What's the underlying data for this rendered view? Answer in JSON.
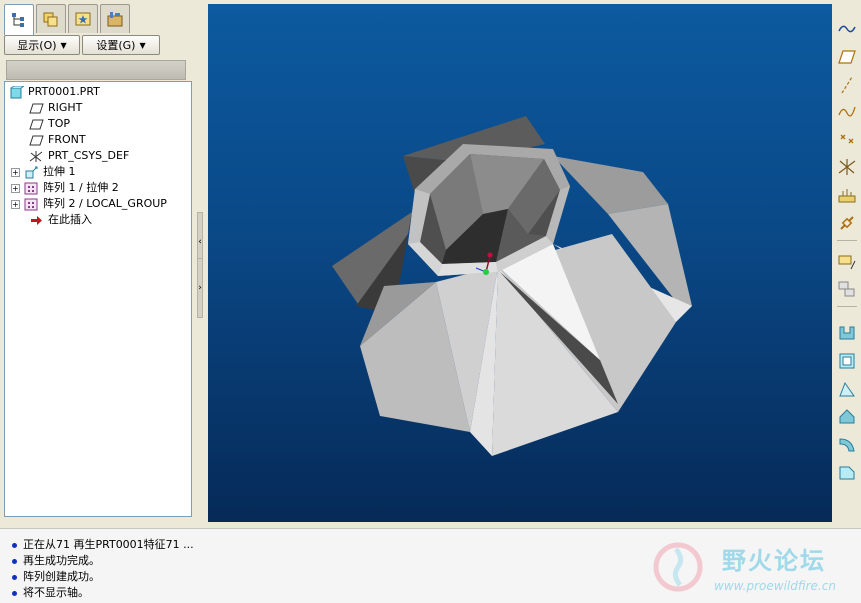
{
  "nav_tabs": [
    {
      "name": "model-tree-tab",
      "icon": "model-tree-icon"
    },
    {
      "name": "folder-browser-tab",
      "icon": "folder-icon"
    },
    {
      "name": "favorites-tab",
      "icon": "favorites-icon"
    },
    {
      "name": "connections-tab",
      "icon": "connections-icon"
    }
  ],
  "tree_toolbar": {
    "show_label": "显示(O)",
    "settings_label": "设置(G)"
  },
  "tree": {
    "root": "PRT0001.PRT",
    "items": [
      {
        "label": "RIGHT",
        "icon": "datum-plane-icon"
      },
      {
        "label": "TOP",
        "icon": "datum-plane-icon"
      },
      {
        "label": "FRONT",
        "icon": "datum-plane-icon"
      },
      {
        "label": "PRT_CSYS_DEF",
        "icon": "coordinate-system-icon"
      },
      {
        "label": "拉伸 1",
        "icon": "extrude-icon"
      },
      {
        "label": "阵列 1 / 拉伸 2",
        "icon": "pattern-icon"
      },
      {
        "label": "阵列 2 / LOCAL_GROUP",
        "icon": "pattern-icon"
      },
      {
        "label": "在此插入",
        "icon": "insert-here-arrow-icon"
      }
    ]
  },
  "messages": [
    "正在从71 再生PRT0001特征71 ...",
    "再生成功完成。",
    "阵列创建成功。",
    "将不显示轴。"
  ],
  "watermark": {
    "title": "野火论坛",
    "url": "www.proewildfire.cn"
  },
  "right_toolbar": [
    "datum-plane-display-icon",
    "datum-plane-icon",
    "datum-axis-icon",
    "datum-curve-icon",
    "datum-point-icon",
    "coordinate-system-icon",
    "analysis-icon",
    "chain-icon",
    "sketch-icon",
    "sketch-reference-icon",
    "extrude-icon",
    "shell-icon",
    "draft-icon",
    "rib-icon",
    "round-icon",
    "chamfer-icon"
  ],
  "colors": {
    "viewport_top": "#0c5aa0",
    "viewport_bottom": "#062a58",
    "message_bullet": "#1030c0",
    "insert_arrow": "#c01818"
  }
}
